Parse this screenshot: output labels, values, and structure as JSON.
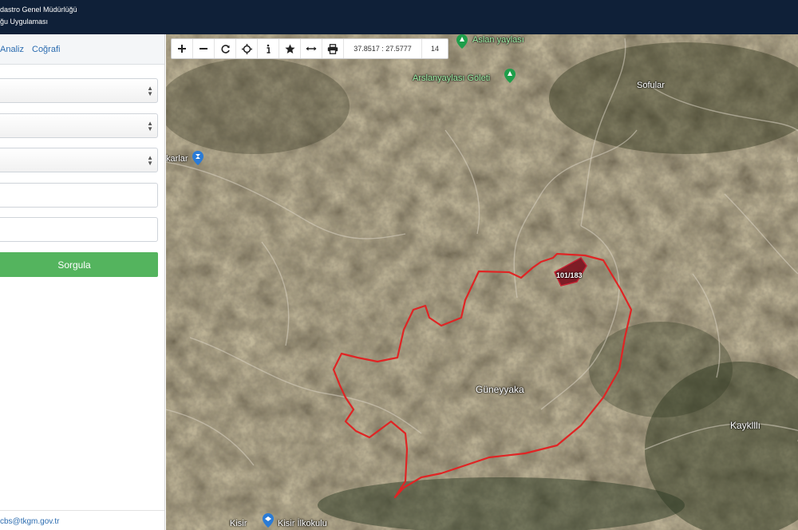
{
  "header": {
    "title_line1": "dastro Genel Müdürlüğü",
    "title_line2": "ğu Uygulaması"
  },
  "sidebar": {
    "tabs": [
      {
        "label": "Analiz"
      },
      {
        "label": "Coğrafi"
      }
    ],
    "selects": [
      {
        "value": ""
      },
      {
        "value": ""
      },
      {
        "value": ""
      }
    ],
    "inputs": [
      {
        "value": ""
      },
      {
        "value": ""
      }
    ],
    "query_button_label": "Sorgula",
    "footer_email": "cbs@tkgm.gov.tr"
  },
  "map": {
    "toolbar": {
      "icons": [
        "zoom-in-icon",
        "zoom-out-icon",
        "refresh-icon",
        "locate-icon",
        "info-icon",
        "favorite-star-icon",
        "measure-icon",
        "print-icon"
      ],
      "coordinates": "37.8517 : 27.5777",
      "zoom_level": "14"
    },
    "place_labels": {
      "aslan_yaylasi": "Aslan yaylası",
      "arslanyaylasi_goleti": "Arslanyaylası Göleti",
      "sofular": "Sofular",
      "karlar": "karlar",
      "guneyyaka": "Güneyyaka",
      "kaykilli": "Kayklllı",
      "kisir": "Kisir",
      "kisir_ilkokulu": "Kisir İlkokulu"
    },
    "parcel_label": "101/183",
    "colors": {
      "boundary": "#e02424",
      "parcel_fill": "#7a0f1c",
      "poi_green": "#1e9e4a",
      "poi_blue": "#2a7bd6"
    }
  }
}
